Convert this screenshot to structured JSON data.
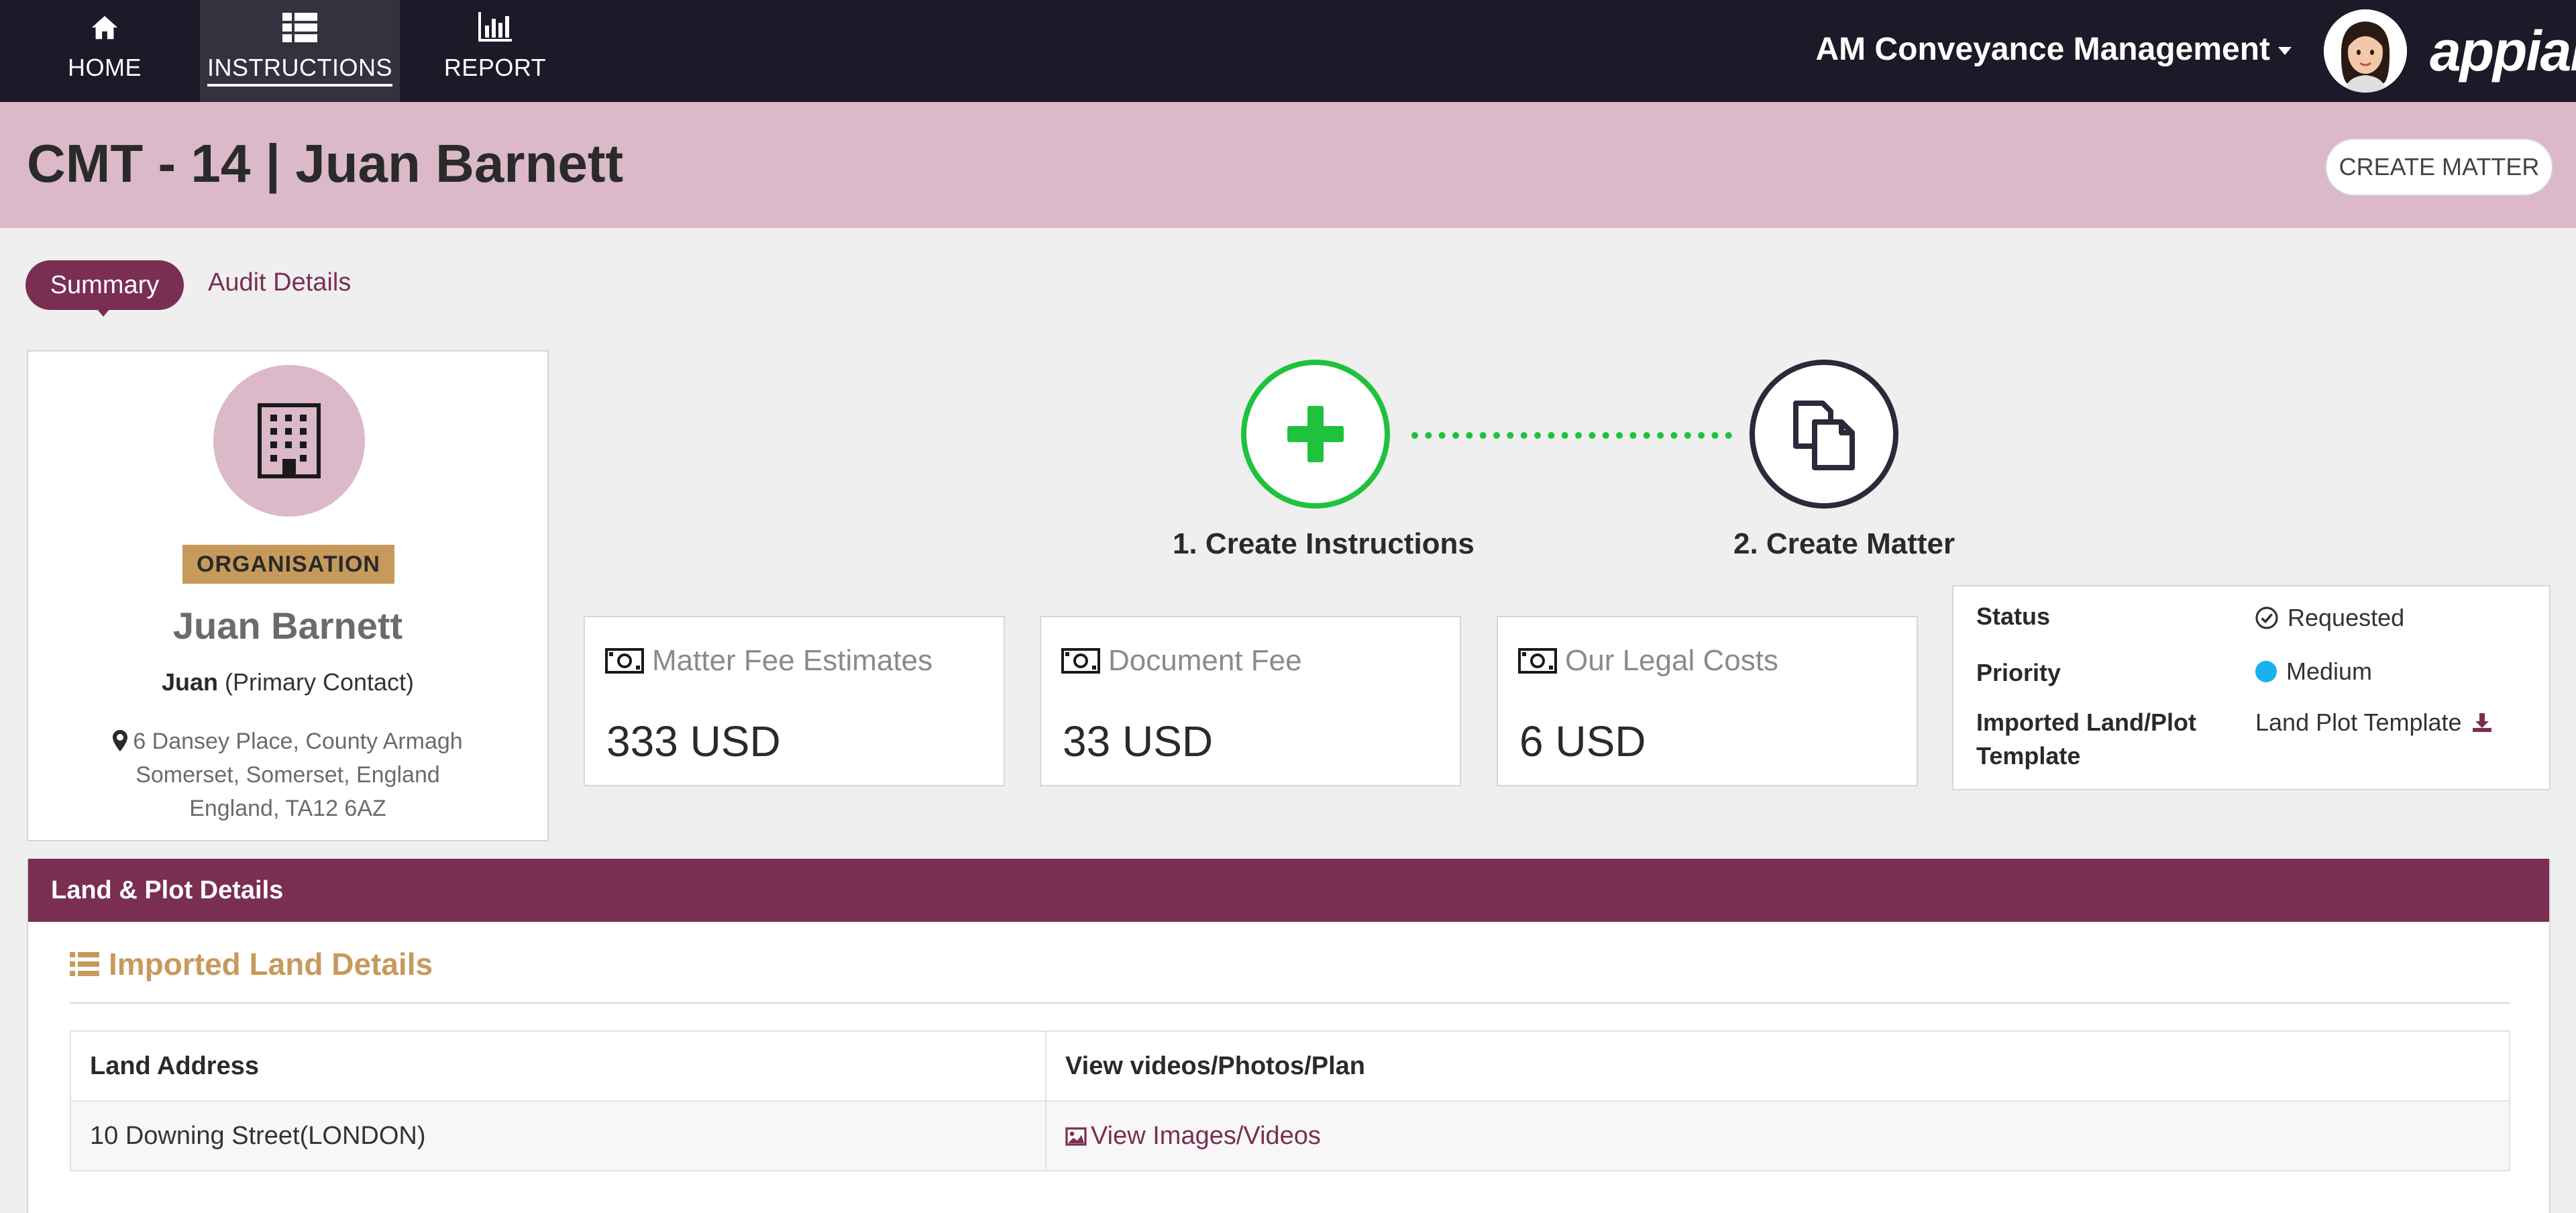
{
  "nav": {
    "items": [
      {
        "label": "HOME",
        "icon": "home-icon"
      },
      {
        "label": "INSTRUCTIONS",
        "icon": "list-icon"
      },
      {
        "label": "REPORT",
        "icon": "bar-chart-icon"
      }
    ],
    "app_name": "AM Conveyance Management",
    "logo": "appian"
  },
  "header": {
    "title": "CMT - 14 | Juan Barnett",
    "create_matter": "CREATE MATTER"
  },
  "tabs": [
    {
      "label": "Summary",
      "active": true
    },
    {
      "label": "Audit Details",
      "active": false
    }
  ],
  "contact": {
    "badge": "ORGANISATION",
    "name": "Juan Barnett",
    "first_name": "Juan",
    "role": "(Primary Contact)",
    "address_lines": [
      "6 Dansey Place, County Armagh",
      "Somerset, Somerset, England",
      "England, TA12 6AZ"
    ]
  },
  "process": {
    "step1": "1. Create Instructions",
    "step2": "2. Create Matter"
  },
  "fees": [
    {
      "label": "Matter Fee Estimates",
      "value": "333 USD"
    },
    {
      "label": "Document Fee",
      "value": "33 USD"
    },
    {
      "label": "Our Legal Costs",
      "value": "6 USD"
    }
  ],
  "status_card": {
    "status_key": "Status",
    "status_value": "Requested",
    "priority_key": "Priority",
    "priority_value": "Medium",
    "priority_color": "#1ab1f0",
    "template_key": "Imported Land/Plot Template",
    "template_value": "Land Plot Template"
  },
  "land": {
    "section_title": "Land & Plot Details",
    "subtitle": "Imported Land Details",
    "columns": [
      "Land Address",
      "View videos/Photos/Plan"
    ],
    "rows": [
      {
        "address": "10 Downing Street(LONDON)",
        "link": "View Images/Videos"
      }
    ]
  },
  "colors": {
    "nav_bg": "#1b1a28",
    "header_bg": "#dbb9c9",
    "accent": "#7a2e52",
    "gold": "#c79a5c",
    "success": "#1ec23c"
  }
}
